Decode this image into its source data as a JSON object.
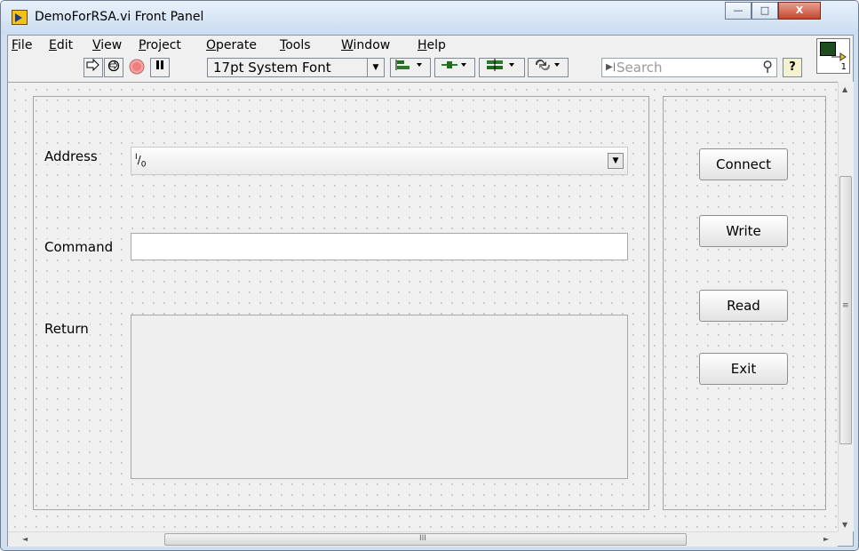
{
  "window": {
    "title": "DemoForRSA.vi Front Panel",
    "minimize_glyph": "—",
    "maximize_glyph": "□",
    "close_glyph": "X"
  },
  "menubar": {
    "items": [
      {
        "hotkey": "F",
        "rest": "ile"
      },
      {
        "hotkey": "E",
        "rest": "dit"
      },
      {
        "hotkey": "V",
        "rest": "iew"
      },
      {
        "hotkey": "P",
        "rest": "roject"
      },
      {
        "hotkey": "O",
        "rest": "perate"
      },
      {
        "hotkey": "T",
        "rest": "ools"
      },
      {
        "hotkey": "W",
        "rest": "indow"
      },
      {
        "hotkey": "H",
        "rest": "elp"
      }
    ]
  },
  "toolbar": {
    "font_selector": "17pt System Font",
    "search_placeholder": "Search",
    "help_glyph": "?",
    "icons": {
      "run": "run-arrow-icon",
      "run_continuously": "run-continuously-icon",
      "abort": "abort-icon",
      "pause": "pause-icon",
      "align": "align-objects-icon",
      "distribute": "distribute-objects-icon",
      "resize": "resize-objects-icon",
      "reorder": "reorder-icon"
    },
    "vi_icon_number": "1"
  },
  "panel": {
    "address_label": "Address",
    "address_value": "",
    "address_io_glyph": "I/O",
    "command_label": "Command",
    "command_value": "",
    "return_label": "Return",
    "return_value": "",
    "buttons": {
      "connect": "Connect",
      "write": "Write",
      "read": "Read",
      "exit": "Exit"
    }
  },
  "scrollbars": {
    "vertical_up": "▲",
    "vertical_down": "▼",
    "vertical_mid": "≡",
    "horizontal_left": "◄",
    "horizontal_right": "►",
    "horizontal_mid": "III"
  }
}
